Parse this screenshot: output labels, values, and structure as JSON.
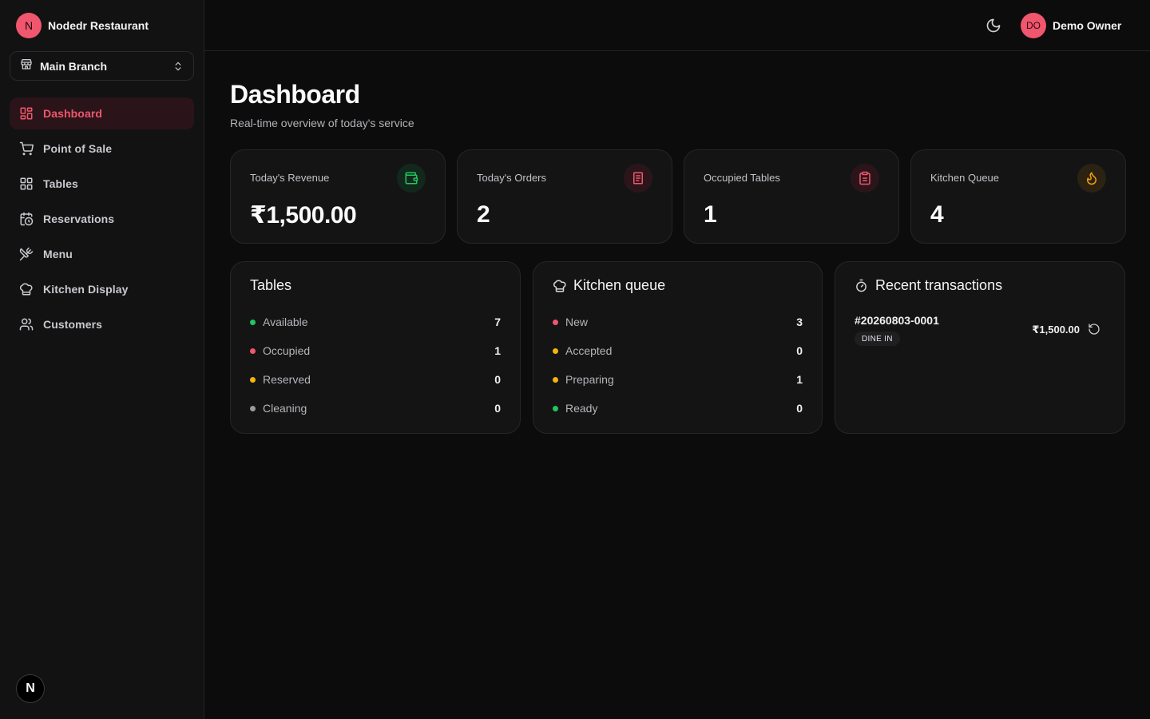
{
  "sidebar": {
    "brand_initial": "N",
    "brand_name": "Nodedr Restaurant",
    "branch": "Main Branch",
    "items": [
      {
        "label": "Dashboard",
        "icon": "layout-dashboard-icon",
        "active": true
      },
      {
        "label": "Point of Sale",
        "icon": "shopping-cart-icon"
      },
      {
        "label": "Tables",
        "icon": "grid-icon"
      },
      {
        "label": "Reservations",
        "icon": "calendar-clock-icon"
      },
      {
        "label": "Menu",
        "icon": "utensils-crossed-icon"
      },
      {
        "label": "Kitchen Display",
        "icon": "chef-hat-icon"
      },
      {
        "label": "Customers",
        "icon": "users-icon"
      }
    ],
    "footer_badge": "N"
  },
  "header": {
    "theme_icon": "moon-icon",
    "user_initials": "DO",
    "user_name": "Demo Owner"
  },
  "page": {
    "title": "Dashboard",
    "subtitle": "Real-time overview of today's service"
  },
  "stats": [
    {
      "label": "Today's Revenue",
      "value": "₹1,500.00",
      "icon": "wallet-icon",
      "color": "#22c55e"
    },
    {
      "label": "Today's Orders",
      "value": "2",
      "icon": "receipt-icon",
      "color": "#f0566d"
    },
    {
      "label": "Occupied Tables",
      "value": "1",
      "icon": "clipboard-icon",
      "color": "#f0566d"
    },
    {
      "label": "Kitchen Queue",
      "value": "4",
      "icon": "flame-icon",
      "color": "#f59e0b"
    }
  ],
  "tables_panel": {
    "title": "Tables",
    "rows": [
      {
        "label": "Available",
        "count": "7",
        "color": "#22c55e"
      },
      {
        "label": "Occupied",
        "count": "1",
        "color": "#f0566d"
      },
      {
        "label": "Reserved",
        "count": "0",
        "color": "#f5b50a"
      },
      {
        "label": "Cleaning",
        "count": "0",
        "color": "#9a9aa0"
      }
    ]
  },
  "kitchen_panel": {
    "title": "Kitchen queue",
    "icon": "chef-hat-icon",
    "rows": [
      {
        "label": "New",
        "count": "3",
        "color": "#f0566d"
      },
      {
        "label": "Accepted",
        "count": "0",
        "color": "#f5b50a"
      },
      {
        "label": "Preparing",
        "count": "1",
        "color": "#f5b50a"
      },
      {
        "label": "Ready",
        "count": "0",
        "color": "#22c55e"
      }
    ]
  },
  "transactions_panel": {
    "title": "Recent transactions",
    "icon": "timer-icon",
    "items": [
      {
        "id": "#20260803-0001",
        "type": "DINE IN",
        "amount": "₹1,500.00"
      }
    ]
  }
}
